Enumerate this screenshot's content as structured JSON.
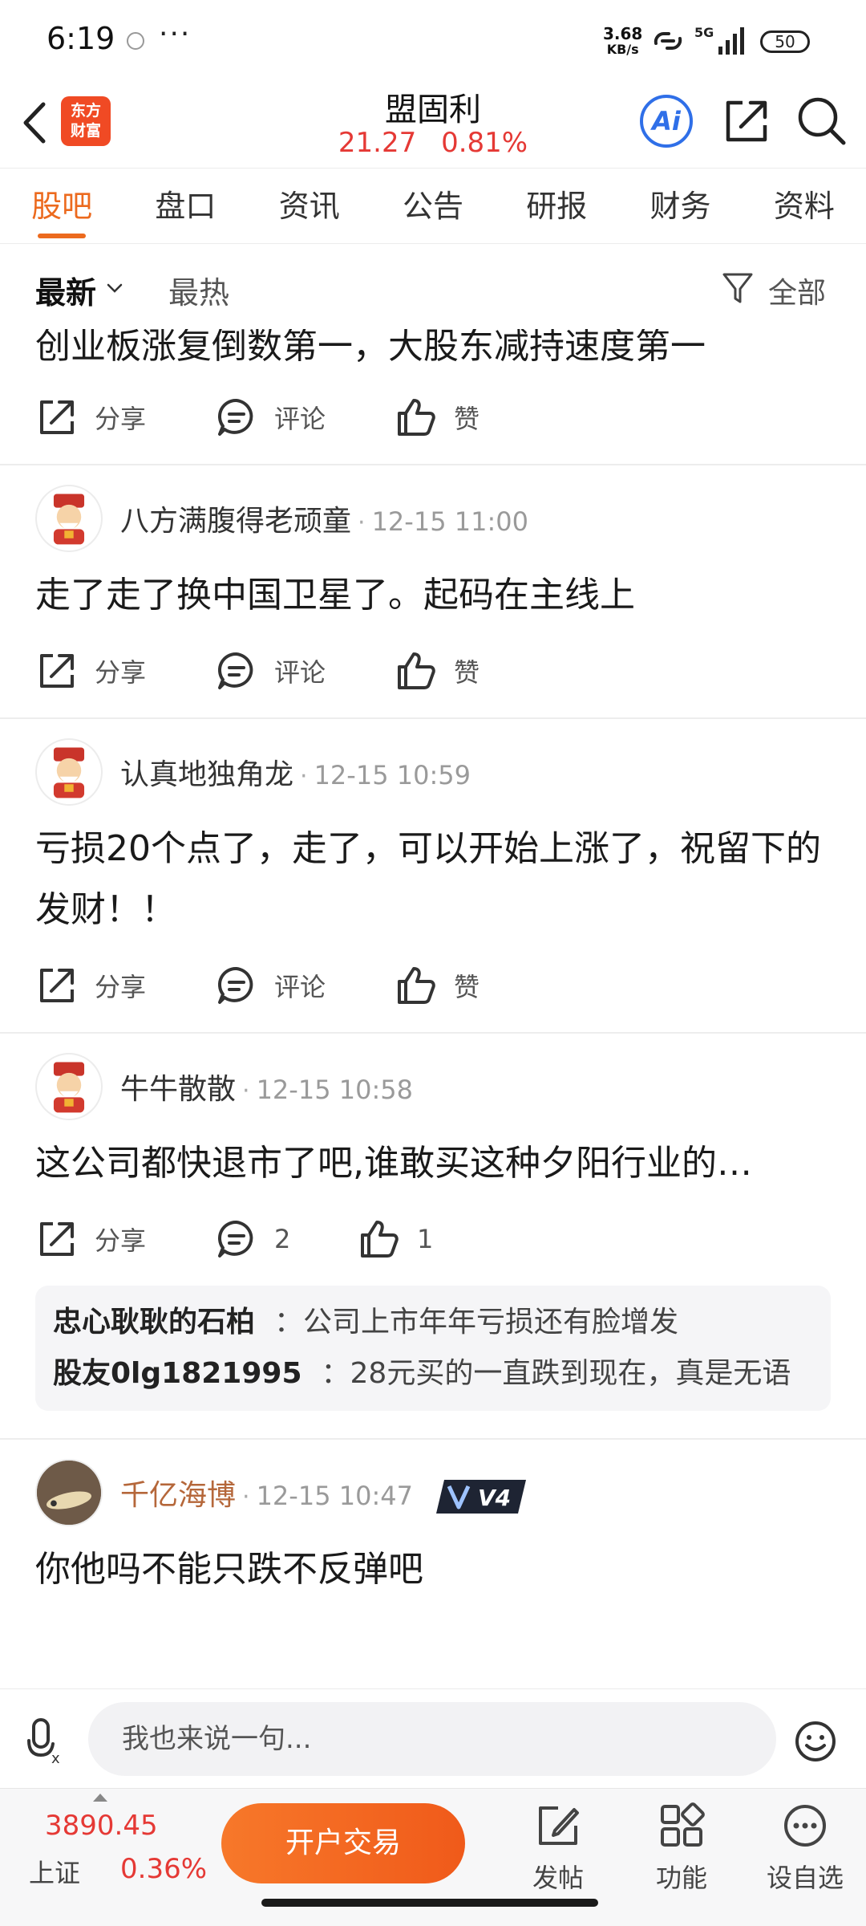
{
  "status_bar": {
    "time": "6:19",
    "net_speed_value": "3.68",
    "net_speed_unit": "KB/s",
    "network": "5G",
    "battery": "50"
  },
  "header": {
    "logo_line1": "东方",
    "logo_line2": "财富",
    "stock_name": "盟固利",
    "price": "21.27",
    "change": "0.81%",
    "ai_label": "Ai"
  },
  "tabs": [
    {
      "label": "股吧",
      "active": true
    },
    {
      "label": "盘口"
    },
    {
      "label": "资讯"
    },
    {
      "label": "公告"
    },
    {
      "label": "研报"
    },
    {
      "label": "财务"
    },
    {
      "label": "资料"
    }
  ],
  "filter": {
    "latest": "最新",
    "hot": "最热",
    "all": "全部"
  },
  "actions": {
    "share": "分享",
    "comment": "评论",
    "like": "赞"
  },
  "posts": [
    {
      "text": "创业板涨复倒数第一，大股东减持速度第一"
    },
    {
      "author": "八方满腹得老顽童",
      "time": "12-15 11:00",
      "text": "走了走了换中国卫星了。起码在主线上"
    },
    {
      "author": "认真地独角龙",
      "time": "12-15 10:59",
      "text": "亏损20个点了，走了，可以开始上涨了，祝留下的发财！！"
    },
    {
      "author": "牛牛散散",
      "time": "12-15 10:58",
      "text": "这公司都快退市了吧,谁敢买这种夕阳行业的…",
      "comment_count": "2",
      "like_count": "1",
      "replies": [
        {
          "name": "忠心耿耿的石柏",
          "text": "：公司上市年年亏损还有脸增发"
        },
        {
          "name": "股友0lg1821995",
          "text": "：28元买的一直跌到现在，真是无语"
        }
      ]
    },
    {
      "author": "千亿海博",
      "time": "12-15 10:47",
      "badge": "V4",
      "text": "你他吗不能只跌不反弹吧"
    }
  ],
  "comment_bar": {
    "placeholder": "我也来说一句..."
  },
  "bottom_nav": {
    "index_value": "3890.45",
    "index_name": "上证",
    "index_change": "0.36%",
    "trade_button": "开户交易",
    "post": "发帖",
    "functions": "功能",
    "watchlist": "设自选"
  },
  "colors": {
    "accent_orange": "#ec6a1e",
    "price_red": "#e53935",
    "ai_blue": "#2f6fe8"
  }
}
